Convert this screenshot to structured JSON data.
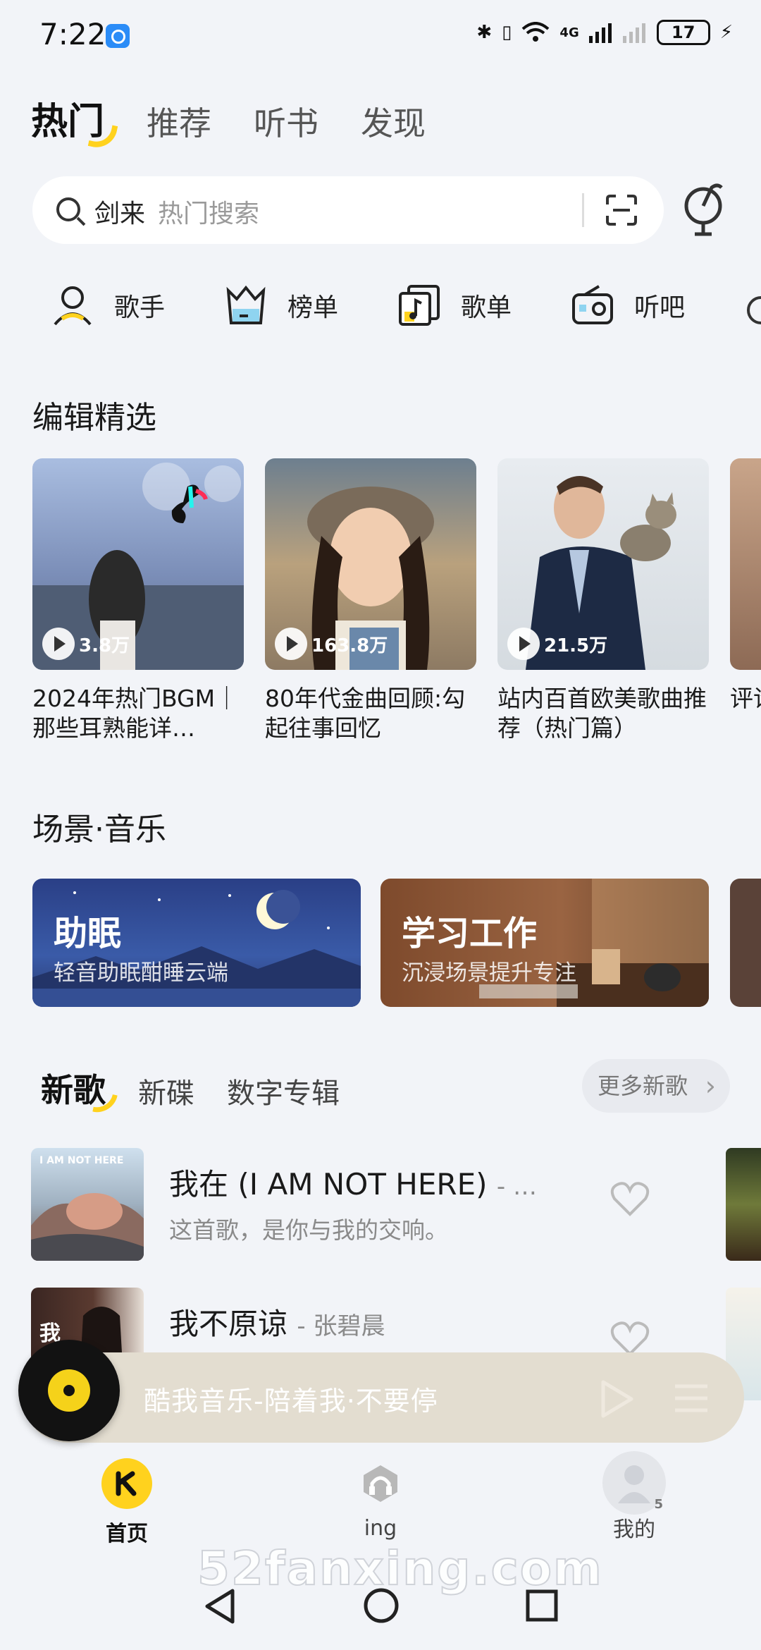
{
  "status_bar": {
    "time": "7:22",
    "battery": "17",
    "network": "4G"
  },
  "top_tabs": [
    {
      "label": "热门",
      "active": true
    },
    {
      "label": "推荐",
      "active": false
    },
    {
      "label": "听书",
      "active": false
    },
    {
      "label": "发现",
      "active": false
    }
  ],
  "search": {
    "value": "剑来",
    "placeholder": "热门搜索"
  },
  "quick_entries": [
    {
      "label": "歌手",
      "icon": "singer-icon"
    },
    {
      "label": "榜单",
      "icon": "chart-icon"
    },
    {
      "label": "歌单",
      "icon": "playlist-icon"
    },
    {
      "label": "听吧",
      "icon": "radio-icon"
    }
  ],
  "editorial": {
    "title": "编辑精选",
    "cards": [
      {
        "plays": "3.8万",
        "title": "2024年热门BGM｜那些耳熟能详…"
      },
      {
        "plays": "163.8万",
        "title": "80年代金曲回顾:勾起往事回忆"
      },
      {
        "plays": "21.5万",
        "title": "站内百首欧美歌曲推荐（热门篇）"
      },
      {
        "plays": "",
        "title": "评论对口"
      }
    ]
  },
  "scene": {
    "title": "场景·音乐",
    "cards": [
      {
        "title": "助眠",
        "subtitle": "轻音助眠酣睡云端"
      },
      {
        "title": "学习工作",
        "subtitle": "沉浸场景提升专注"
      }
    ]
  },
  "new_songs": {
    "tabs": [
      {
        "label": "新歌",
        "active": true
      },
      {
        "label": "新碟",
        "active": false
      },
      {
        "label": "数字专辑",
        "active": false
      }
    ],
    "more_label": "更多新歌",
    "songs": [
      {
        "title": "我在 (I AM NOT HERE)",
        "artist": "- …",
        "desc": "这首歌，是你与我的交响。",
        "cover_text": "I AM NOT HERE"
      },
      {
        "title": "我不原谅",
        "artist": "- 张碧晨",
        "desc": "",
        "cover_text": "我"
      }
    ]
  },
  "player": {
    "text": "酷我音乐-陪着我·不要停"
  },
  "bottom_nav": [
    {
      "label": "首页",
      "active": true
    },
    {
      "label": "ing",
      "active": false
    },
    {
      "label": "我的",
      "active": false,
      "badge": "5"
    }
  ],
  "watermark": "52fanxing.com",
  "colors": {
    "accent": "#ffd21e",
    "background": "#f2f4f8"
  }
}
